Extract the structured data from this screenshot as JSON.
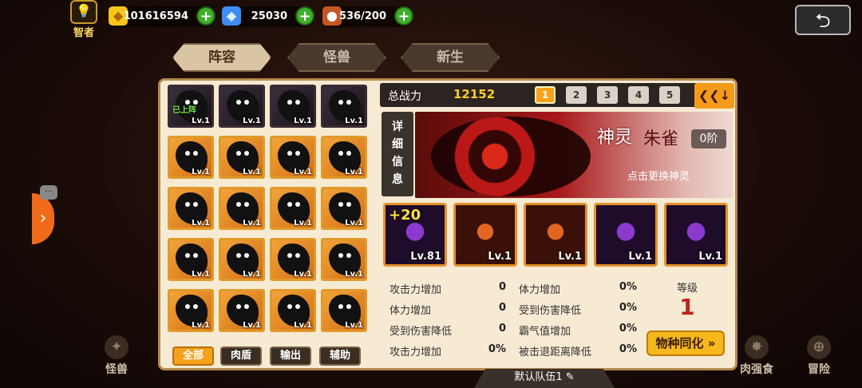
{
  "hud": {
    "rank_label": "智者",
    "gold": "101616594",
    "diamond": "25030",
    "stamina": "536/200"
  },
  "tabs": [
    "阵容",
    "怪兽",
    "新生"
  ],
  "roster": {
    "deployed_tag": "已上阵",
    "cells": [
      {
        "lv": "Lv.1",
        "deployed": true
      },
      {
        "lv": "Lv.1"
      },
      {
        "lv": "Lv.1"
      },
      {
        "lv": "Lv.1"
      },
      {
        "lv": "Lv.1"
      },
      {
        "lv": "Lv.1"
      },
      {
        "lv": "Lv.1"
      },
      {
        "lv": "Lv.1"
      },
      {
        "lv": "Lv.1"
      },
      {
        "lv": "Lv.1"
      },
      {
        "lv": "Lv.1"
      },
      {
        "lv": "Lv.1"
      },
      {
        "lv": "Lv.1"
      },
      {
        "lv": "Lv.1"
      },
      {
        "lv": "Lv.1"
      },
      {
        "lv": "Lv.1"
      },
      {
        "lv": "Lv.1"
      },
      {
        "lv": "Lv.1"
      },
      {
        "lv": "Lv.1"
      },
      {
        "lv": "Lv.1"
      }
    ],
    "filters": [
      "全部",
      "肉盾",
      "输出",
      "辅助"
    ]
  },
  "power": {
    "label": "总战力",
    "value": "12152",
    "slots": [
      "1",
      "2",
      "3",
      "4",
      "5"
    ]
  },
  "detail_label": [
    "详",
    "细",
    "信",
    "息"
  ],
  "spirit": {
    "type": "神灵",
    "name": "朱雀",
    "rank": "0阶",
    "change_hint": "点击更换神灵"
  },
  "team": [
    {
      "lv": "Lv.81",
      "bonus": "+20",
      "color": "purple"
    },
    {
      "lv": "Lv.1",
      "color": "red"
    },
    {
      "lv": "Lv.1",
      "color": "red"
    },
    {
      "lv": "Lv.1",
      "color": "purple"
    },
    {
      "lv": "Lv.1",
      "color": "purple"
    }
  ],
  "stats_left": [
    {
      "label": "攻击力增加",
      "value": "0"
    },
    {
      "label": "体力增加",
      "value": "0"
    },
    {
      "label": "受到伤害降低",
      "value": "0"
    },
    {
      "label": "攻击力增加",
      "value": "0%"
    }
  ],
  "stats_right": [
    {
      "label": "体力增加",
      "value": "0%"
    },
    {
      "label": "受到伤害降低",
      "value": "0%"
    },
    {
      "label": "霸气值增加",
      "value": "0%"
    },
    {
      "label": "被击退距离降低",
      "value": "0%"
    }
  ],
  "level": {
    "label": "等级",
    "value": "1"
  },
  "sync_button": "物种同化",
  "team_name": "默认队伍1",
  "bottom_nav": [
    {
      "label": "怪兽"
    },
    {
      "label": "肉强食"
    },
    {
      "label": "冒险"
    }
  ]
}
